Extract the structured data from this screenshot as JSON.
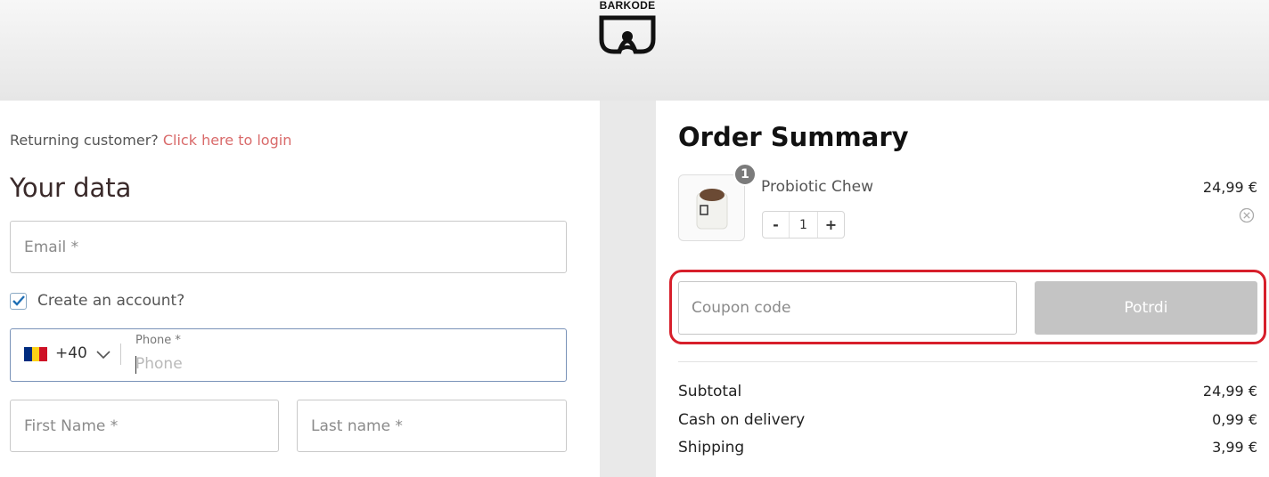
{
  "brand": {
    "name": "BARKODE"
  },
  "checkout": {
    "returning_text": "Returning customer?",
    "login_link": "Click here to login",
    "section_title": "Your data",
    "email_placeholder": "Email *",
    "create_account_label": "Create an account?",
    "create_account_checked": true,
    "phone": {
      "country_code": "+40",
      "label": "Phone *",
      "placeholder": "Phone",
      "flag_colors": [
        "#002b7f",
        "#fcd116",
        "#ce1126"
      ]
    },
    "first_name_placeholder": "First Name *",
    "last_name_placeholder": "Last name *"
  },
  "order_summary": {
    "title": "Order Summary",
    "item": {
      "name": "Probiotic Chew",
      "price": "24,99 €",
      "quantity": "1",
      "badge": "1",
      "minus": "-",
      "plus": "+"
    },
    "coupon_placeholder": "Coupon code",
    "apply_label": "Potrdi",
    "totals": [
      {
        "label": "Subtotal",
        "value": "24,99 €"
      },
      {
        "label": "Cash on delivery",
        "value": "0,99 €"
      },
      {
        "label": "Shipping",
        "value": "3,99 €"
      }
    ]
  },
  "colors": {
    "accent_link": "#d96a6a",
    "highlight": "#d71f2b",
    "button_disabled": "#c4c4c4"
  }
}
